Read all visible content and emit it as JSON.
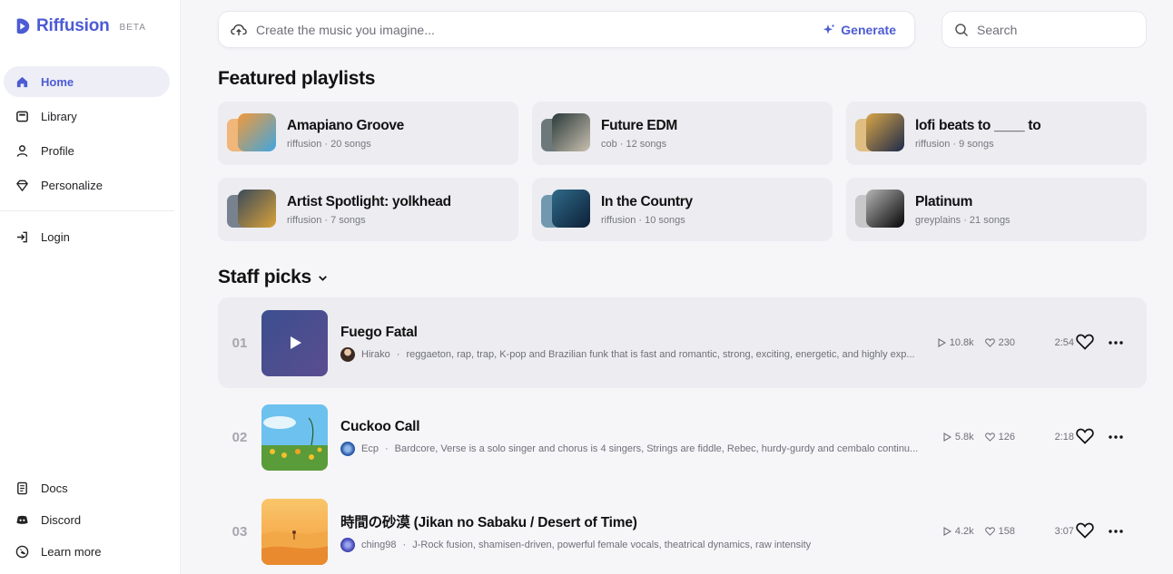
{
  "brand": {
    "name": "Riffusion",
    "badge": "BETA"
  },
  "nav": {
    "primary": [
      {
        "label": "Home",
        "icon": "home-icon",
        "active": true
      },
      {
        "label": "Library",
        "icon": "library-icon",
        "active": false
      },
      {
        "label": "Profile",
        "icon": "profile-icon",
        "active": false
      },
      {
        "label": "Personalize",
        "icon": "diamond-icon",
        "active": false
      }
    ],
    "login": {
      "label": "Login",
      "icon": "login-icon"
    },
    "footer": [
      {
        "label": "Docs",
        "icon": "docs-icon"
      },
      {
        "label": "Discord",
        "icon": "discord-icon"
      },
      {
        "label": "Learn more",
        "icon": "learn-more-icon"
      }
    ]
  },
  "prompt": {
    "placeholder": "Create the music you imagine...",
    "generate_label": "Generate"
  },
  "search": {
    "placeholder": "Search"
  },
  "featured": {
    "title": "Featured playlists",
    "playlists": [
      {
        "title": "Amapiano Groove",
        "subtitle": "riffusion · 20 songs",
        "colors": [
          "#f2993a",
          "#3fa6e0"
        ]
      },
      {
        "title": "Future EDM",
        "subtitle": "cob · 12 songs",
        "colors": [
          "#2a3a3a",
          "#c9c0b0"
        ]
      },
      {
        "title": "lofi beats to ____ to",
        "subtitle": "riffusion · 9 songs",
        "colors": [
          "#d8a548",
          "#1e2a4a"
        ]
      },
      {
        "title": "Artist Spotlight: yolkhead",
        "subtitle": "riffusion · 7 songs",
        "colors": [
          "#3b4a5a",
          "#d9a23a"
        ]
      },
      {
        "title": "In the Country",
        "subtitle": "riffusion · 10 songs",
        "colors": [
          "#2f6b8a",
          "#0d1f36"
        ]
      },
      {
        "title": "Platinum",
        "subtitle": "greyplains · 21 songs",
        "colors": [
          "#b5b5b5",
          "#050505"
        ]
      }
    ]
  },
  "staff": {
    "title": "Staff picks",
    "tracks": [
      {
        "num": "01",
        "title": "Fuego Fatal",
        "artist": "Hirako",
        "description": "reggaeton, rap, trap, K-pop and Brazilian funk that is fast and romantic, strong, exciting, energetic, and highly exp...",
        "plays": "10.8k",
        "likes": "230",
        "duration": "2:54",
        "highlighted": true,
        "art": [
          "#3c4f8f",
          "#5a4d8f"
        ]
      },
      {
        "num": "02",
        "title": "Cuckoo Call",
        "artist": "Ecp",
        "description": "Bardcore, Verse is a solo singer and chorus is 4 singers, Strings are fiddle, Rebec, hurdy-gurdy and cembalo continu...",
        "plays": "5.8k",
        "likes": "126",
        "duration": "2:18",
        "highlighted": false,
        "art": [
          "#4fb2e6",
          "#6fb04a"
        ]
      },
      {
        "num": "03",
        "title": "時間の砂漠 (Jikan no Sabaku / Desert of Time)",
        "artist": "ching98",
        "description": "J-Rock fusion, shamisen-driven, powerful female vocals, theatrical dynamics, raw intensity",
        "plays": "4.2k",
        "likes": "158",
        "duration": "3:07",
        "highlighted": false,
        "art": [
          "#f7b04a",
          "#f08a2c"
        ]
      }
    ]
  },
  "colors": {
    "accent": "#4c5bd4",
    "card_bg": "#ececf1",
    "main_bg": "#f6f6f9"
  }
}
